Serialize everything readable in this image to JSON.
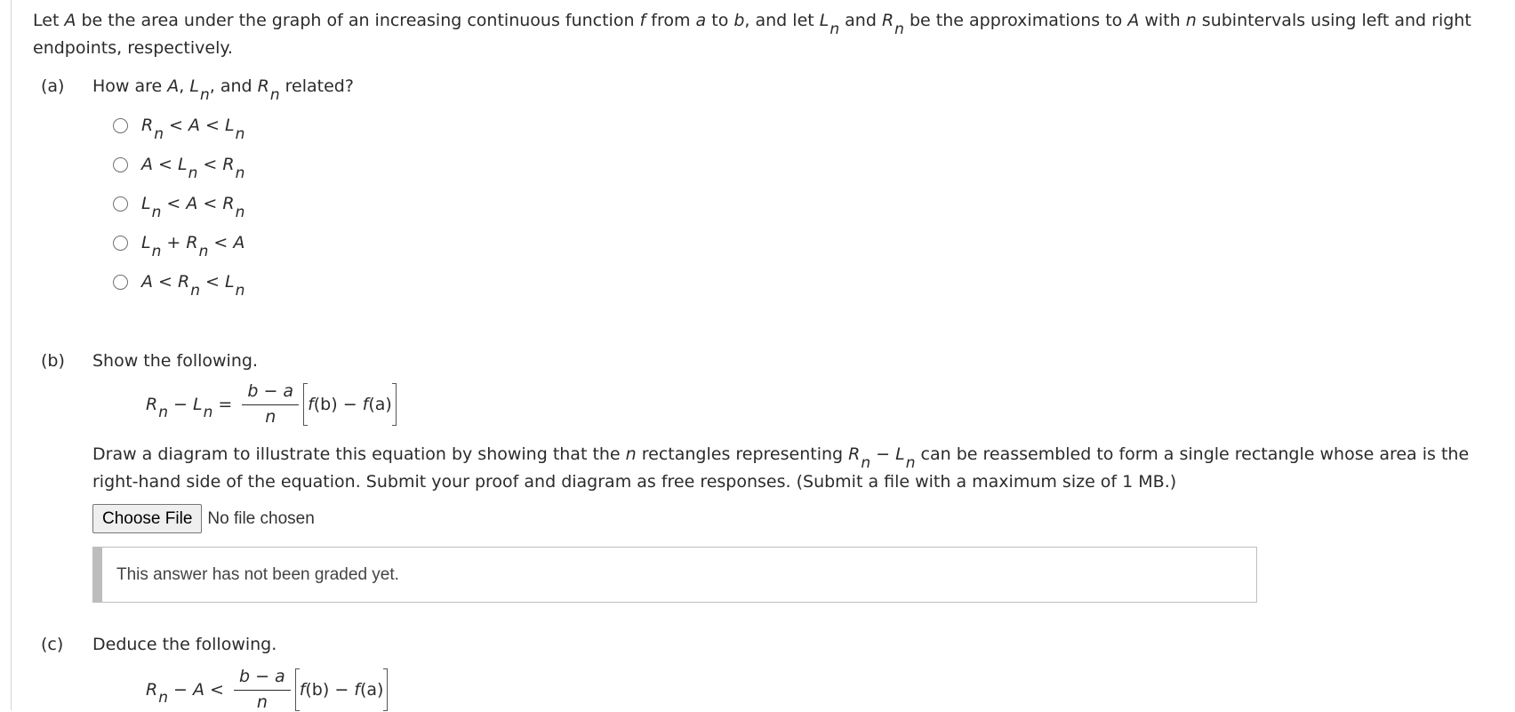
{
  "intro": {
    "t1": "Let ",
    "A": "A",
    "t2": " be the area under the graph of an increasing continuous function ",
    "f": "f",
    "t3": " from ",
    "a": "a",
    "t4": " to ",
    "b": "b",
    "t5": ", and let ",
    "L": "L",
    "n1": "n",
    "t6": " and ",
    "R": "R",
    "n2": "n",
    "t7": " be the approximations to ",
    "A2": "A",
    "t8": " with ",
    "n3": "n",
    "t9": " subintervals using left and right endpoints, respectively."
  },
  "part_a": {
    "label": "(a)",
    "q1": "How are ",
    "A": "A",
    "c1": ", ",
    "L": "L",
    "n1": "n",
    "c2": ", and ",
    "R": "R",
    "n2": "n",
    "q2": " related?",
    "options": [
      {
        "p1": "R",
        "s1": "n",
        "p2": " < A < L",
        "s2": "n",
        "p3": ""
      },
      {
        "p1": "A < L",
        "s1": "n",
        "p2": " < R",
        "s2": "n",
        "p3": ""
      },
      {
        "p1": "L",
        "s1": "n",
        "p2": " < A < R",
        "s2": "n",
        "p3": ""
      },
      {
        "p1": "L",
        "s1": "n",
        "p2": " + R",
        "s2": "n",
        "p3": " < A"
      },
      {
        "p1": "A < R",
        "s1": "n",
        "p2": " < L",
        "s2": "n",
        "p3": ""
      }
    ]
  },
  "part_b": {
    "label": "(b)",
    "heading": "Show the following.",
    "eq": {
      "R": "R",
      "n1": "n",
      "minus": " − ",
      "L": "L",
      "n2": "n",
      "eq": " = ",
      "num": "b − a",
      "den": "n",
      "f1": "f",
      "b": "(b)",
      "m2": " − ",
      "f2": "f",
      "a": "(a)"
    },
    "d1": "Draw a diagram to illustrate this equation by showing that the ",
    "n": "n",
    "d2": " rectangles representing ",
    "R": "R",
    "n1": "n",
    "minus": " − ",
    "L": "L",
    "n2": "n",
    "d3": " can be reassembled to form a single rectangle whose area is the right-hand side of the equation. Submit your proof and diagram as free responses. (Submit a file with a maximum size of 1 MB.)",
    "choose_file": "Choose File",
    "no_file": "No file chosen",
    "graded": "This answer has not been graded yet."
  },
  "part_c": {
    "label": "(c)",
    "heading": "Deduce the following.",
    "eq": {
      "R": "R",
      "n1": "n",
      "minus": " − A < ",
      "num": "b − a",
      "den": "n",
      "f1": "f",
      "b": "(b)",
      "m2": " − ",
      "f2": "f",
      "a": "(a)"
    }
  }
}
